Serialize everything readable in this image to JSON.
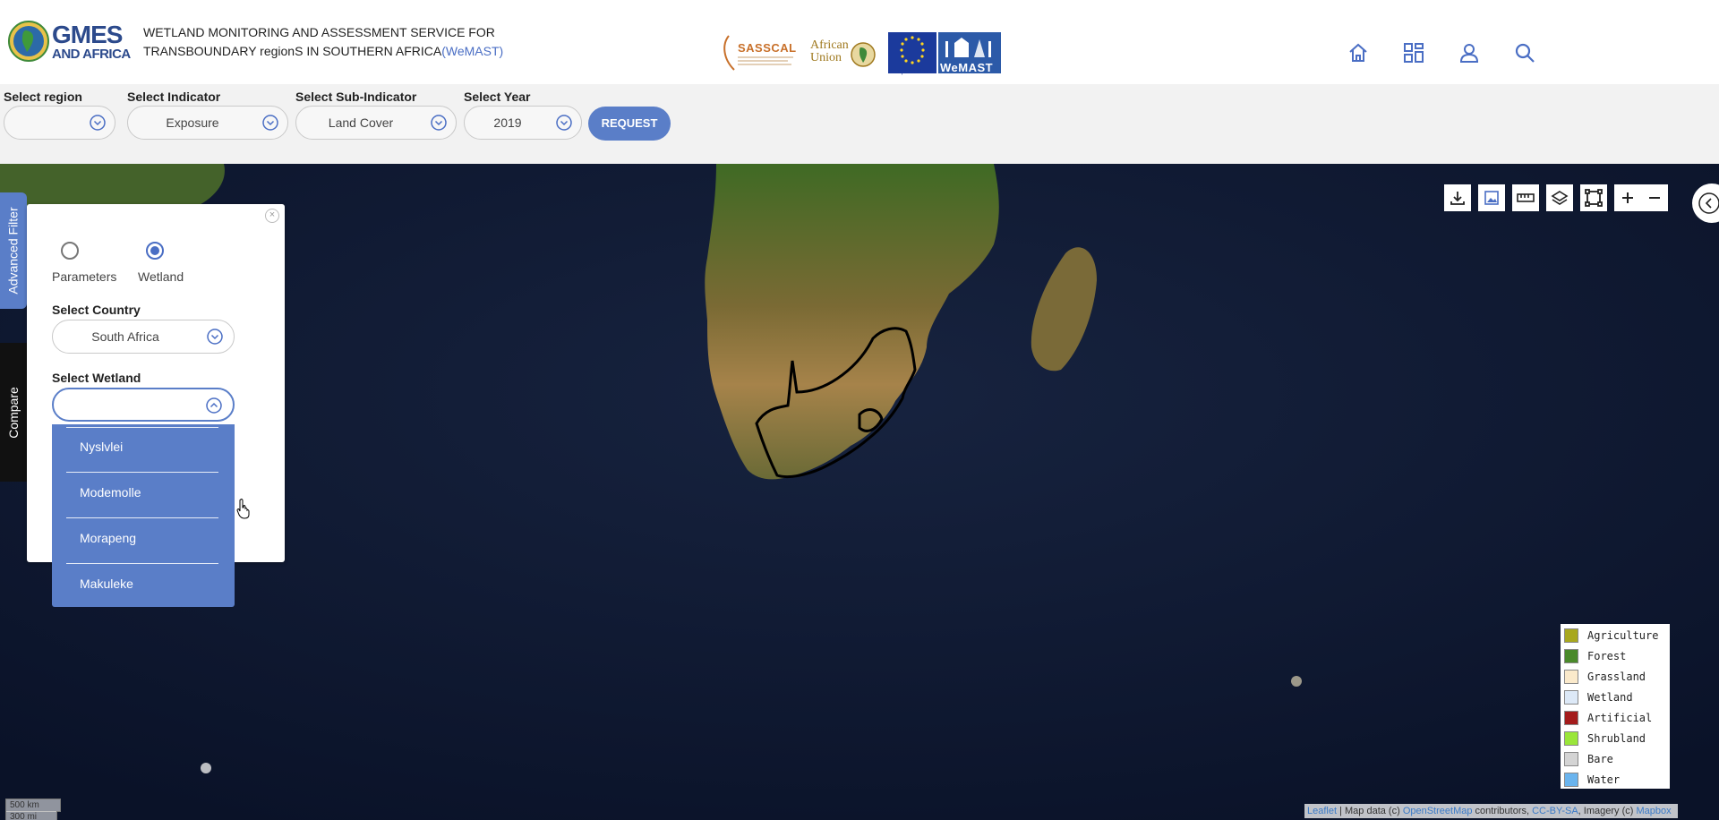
{
  "header": {
    "logo_line1": "GMES",
    "logo_line2": "AND AFRICA",
    "title_line1": "WETLAND MONITORING AND ASSESSMENT SERVICE FOR",
    "title_line2": "TRANSBOUNDARY regionS IN SOUTHERN AFRICA",
    "title_acronym": "(WeMAST)",
    "partners": {
      "sasscal": "SASSCAL",
      "african_union": "African Union",
      "eu_caption": "European Union",
      "wemast": "WeMAST"
    },
    "nav_icons": [
      "home-icon",
      "dashboard-icon",
      "user-icon",
      "search-icon"
    ]
  },
  "toolbar": {
    "region": {
      "label": "Select region",
      "value": ""
    },
    "indicator": {
      "label": "Select Indicator",
      "value": "Exposure"
    },
    "sub_indicator": {
      "label": "Select Sub-Indicator",
      "value": "Land Cover"
    },
    "year": {
      "label": "Select Year",
      "value": "2019"
    },
    "request_label": "REQUEST"
  },
  "side_tabs": {
    "advanced_filter": "Advanced Filter",
    "compare": "Compare"
  },
  "filter_panel": {
    "radio_parameters": "Parameters",
    "radio_wetland": "Wetland",
    "selected_mode": "Wetland",
    "country_label": "Select Country",
    "country_value": "South Africa",
    "wetland_label": "Select Wetland",
    "wetland_value": "",
    "wetland_options": [
      "Nyslvlei",
      "Modemolle",
      "Morapeng",
      "Makuleke"
    ]
  },
  "map_controls": [
    "download-icon",
    "image-export-icon",
    "measure-ruler-icon",
    "layers-icon",
    "fullscreen-icon",
    "zoom-in-icon",
    "zoom-out-icon"
  ],
  "legend": [
    {
      "label": "Agriculture",
      "color": "#a8a81e"
    },
    {
      "label": "Forest",
      "color": "#4a8a2a"
    },
    {
      "label": "Grassland",
      "color": "#fbeacb"
    },
    {
      "label": "Wetland",
      "color": "#dde9f7"
    },
    {
      "label": "Artificial",
      "color": "#a41c1c"
    },
    {
      "label": "Shrubland",
      "color": "#9ae63a"
    },
    {
      "label": "Bare",
      "color": "#d4d4d4"
    },
    {
      "label": "Water",
      "color": "#6ab4ee"
    }
  ],
  "scale": {
    "km": "500 km",
    "mi": "300 mi"
  },
  "attribution": {
    "leaflet": "Leaflet",
    "sep": " | Map data (c) ",
    "osm": "OpenStreetMap",
    "contrib": " contributors, ",
    "license": "CC-BY-SA",
    "imagery": ", Imagery (c) ",
    "mapbox": "Mapbox"
  },
  "colors": {
    "accent": "#5a7ec8",
    "title_accent": "#4a6ec4",
    "brand_dark": "#2c4a8c"
  }
}
